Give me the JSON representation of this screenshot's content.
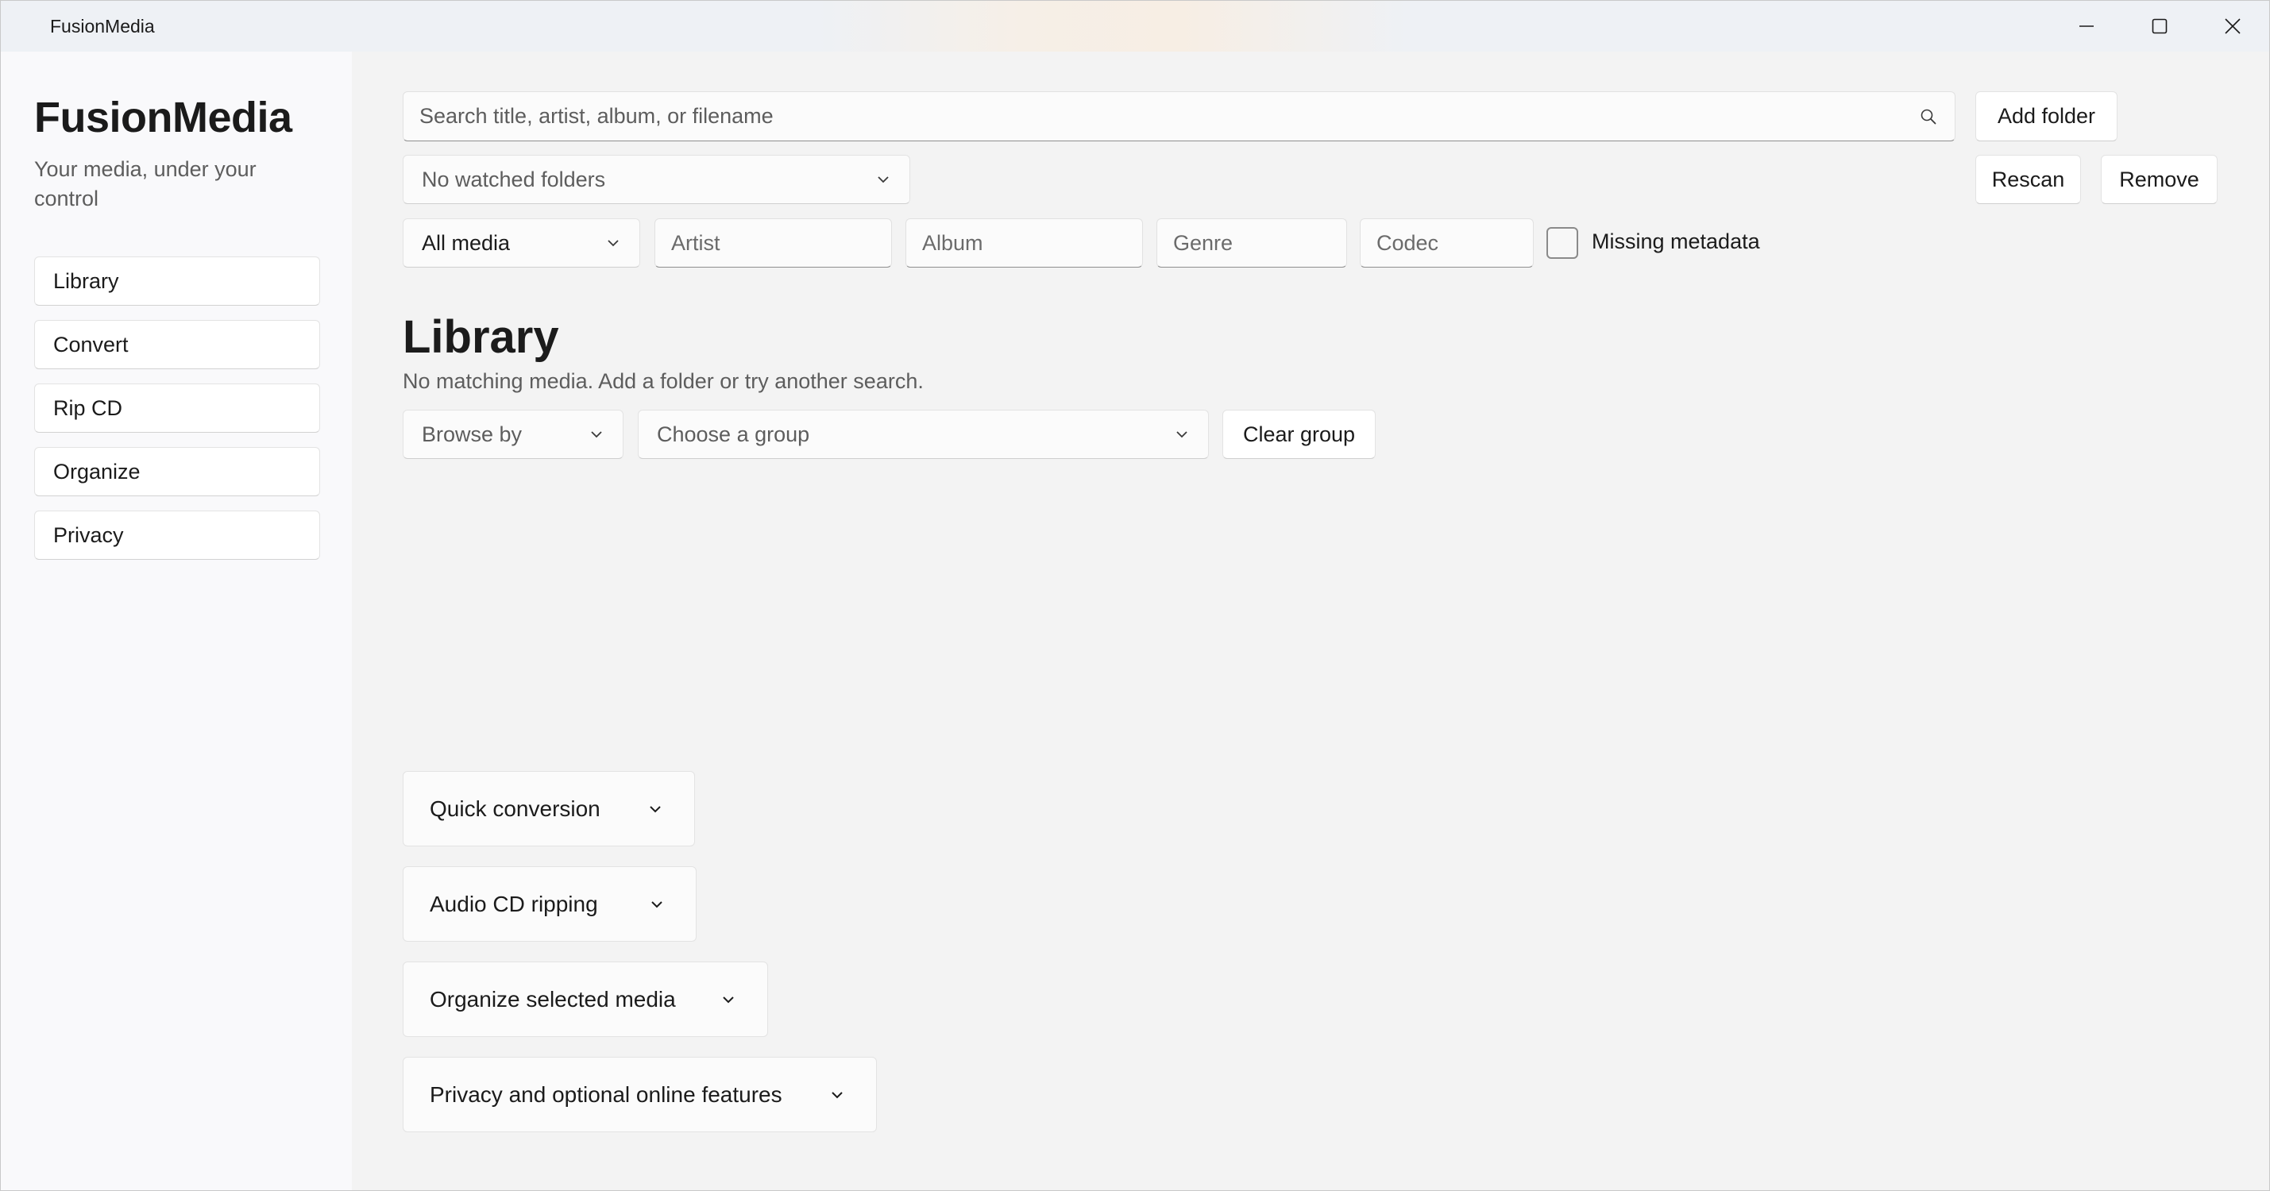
{
  "window": {
    "title": "FusionMedia"
  },
  "sidebar": {
    "brand": "FusionMedia",
    "tagline": "Your media, under your control",
    "items": [
      {
        "label": "Library"
      },
      {
        "label": "Convert"
      },
      {
        "label": "Rip CD"
      },
      {
        "label": "Organize"
      },
      {
        "label": "Privacy"
      }
    ]
  },
  "toolbar": {
    "search_placeholder": "Search title, artist, album, or filename",
    "add_folder_label": "Add folder",
    "folders_selected": "No watched folders",
    "rescan_label": "Rescan",
    "remove_label": "Remove"
  },
  "filters": {
    "media_type": "All media",
    "artist_placeholder": "Artist",
    "album_placeholder": "Album",
    "genre_placeholder": "Genre",
    "codec_placeholder": "Codec",
    "missing_metadata_label": "Missing metadata",
    "missing_metadata_checked": false
  },
  "library": {
    "title": "Library",
    "status": "No matching media. Add a folder or try another search.",
    "browse_by": "Browse by",
    "group_placeholder": "Choose a group",
    "clear_group_label": "Clear group"
  },
  "sections": [
    {
      "label": "Quick conversion"
    },
    {
      "label": "Audio CD ripping"
    },
    {
      "label": "Organize selected media"
    },
    {
      "label": "Privacy and optional online features"
    }
  ]
}
